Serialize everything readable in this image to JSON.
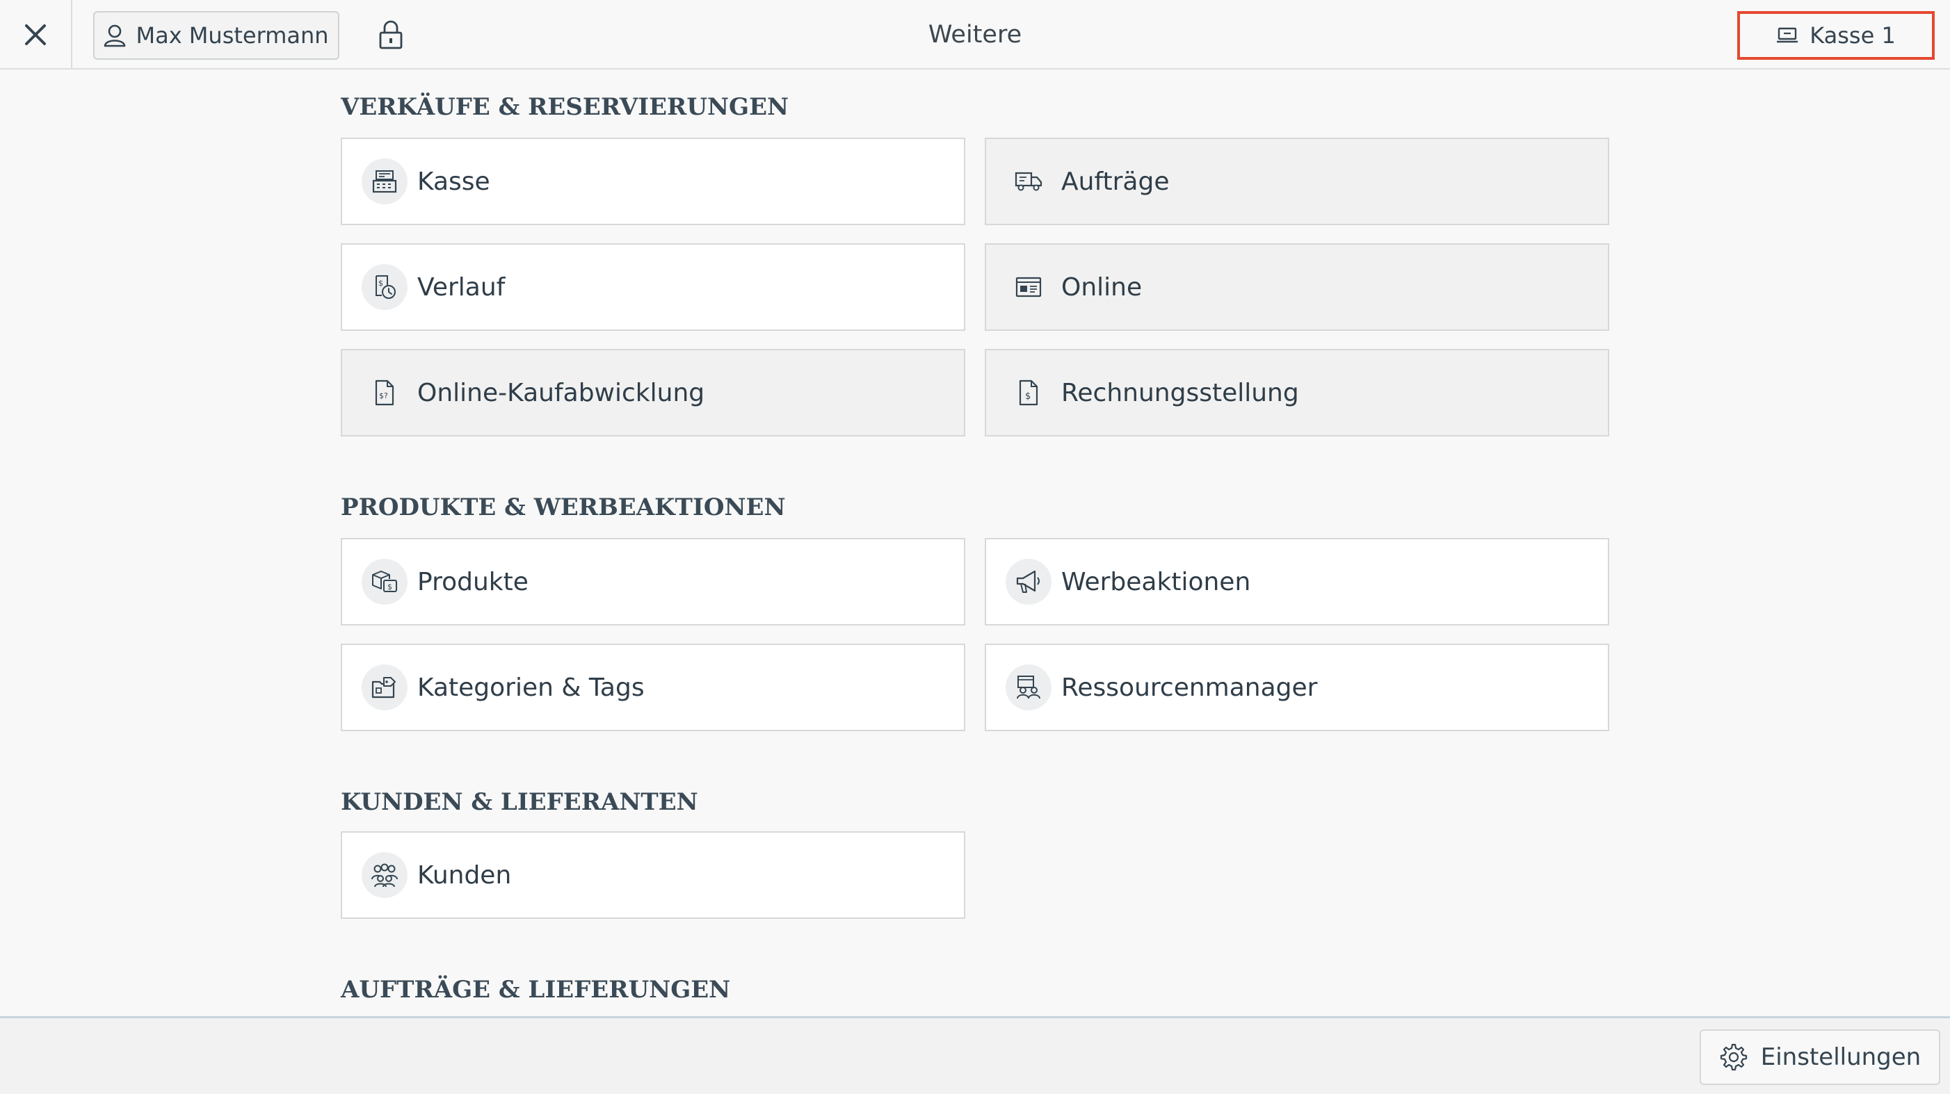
{
  "topbar": {
    "close_icon": "close-icon",
    "user_name": "Max Mustermann",
    "user_icon": "user-icon",
    "lock_icon": "lock-icon",
    "title": "Weitere",
    "register_label": "Kasse 1",
    "register_icon": "cash-register-small-icon",
    "register_highlight_color": "#e4492f"
  },
  "sections": [
    {
      "title": "Verkäufe & Reservierungen",
      "tiles": [
        {
          "label": "Kasse",
          "icon": "cash-register-icon",
          "style": "white"
        },
        {
          "label": "Aufträge",
          "icon": "delivery-truck-icon",
          "style": "grey"
        },
        {
          "label": "Verlauf",
          "icon": "receipt-history-icon",
          "style": "white"
        },
        {
          "label": "Online",
          "icon": "online-card-icon",
          "style": "grey"
        },
        {
          "label": "Online-Kaufabwicklung",
          "icon": "online-checkout-document-icon",
          "style": "grey"
        },
        {
          "label": "Rechnungsstellung",
          "icon": "invoice-document-icon",
          "style": "grey"
        }
      ]
    },
    {
      "title": "Produkte & Werbeaktionen",
      "tiles": [
        {
          "label": "Produkte",
          "icon": "products-box-icon",
          "style": "white"
        },
        {
          "label": "Werbeaktionen",
          "icon": "megaphone-icon",
          "style": "white"
        },
        {
          "label": "Kategorien & Tags",
          "icon": "categories-tags-icon",
          "style": "white"
        },
        {
          "label": "Ressourcenmanager",
          "icon": "resource-manager-icon",
          "style": "white"
        }
      ]
    },
    {
      "title": "Kunden & Lieferanten",
      "tiles": [
        {
          "label": "Kunden",
          "icon": "customers-group-icon",
          "style": "white"
        }
      ]
    },
    {
      "title": "Aufträge & Lieferungen",
      "tiles": []
    }
  ],
  "bottombar": {
    "settings_label": "Einstellungen",
    "settings_icon": "gear-icon"
  },
  "colors": {
    "text": "#344450",
    "tile_border": "#d6d8da",
    "background": "#f8f8f8",
    "accent_red": "#e4492f"
  }
}
